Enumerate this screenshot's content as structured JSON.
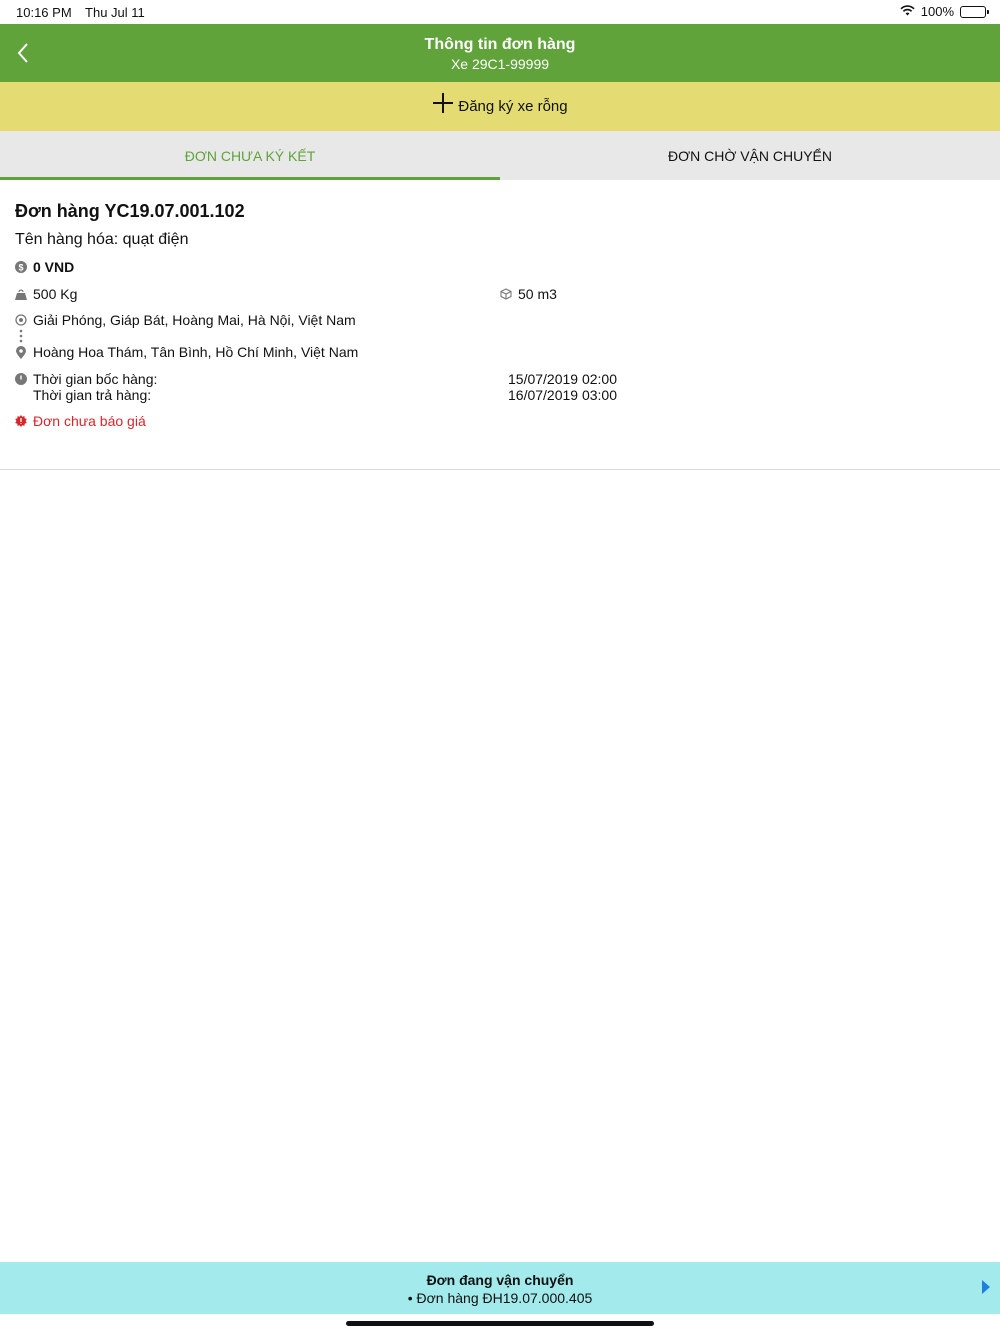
{
  "status_bar": {
    "time": "10:16 PM",
    "date": "Thu Jul 11",
    "battery": "100%"
  },
  "nav": {
    "title": "Thông tin đơn hàng",
    "subtitle": "Xe 29C1-99999"
  },
  "register": {
    "label": "Đăng ký xe rỗng"
  },
  "tabs": [
    {
      "label": "ĐƠN CHƯA KÝ KẾT",
      "active": true
    },
    {
      "label": "ĐƠN CHỜ VẬN CHUYỂN",
      "active": false
    }
  ],
  "order": {
    "title": "Đơn hàng YC19.07.001.102",
    "goods": "Tên hàng hóa: quạt điện",
    "price": "0 VND",
    "weight": "500 Kg",
    "volume": "50 m3",
    "from": "Giải Phóng, Giáp Bát, Hoàng Mai, Hà Nội, Việt Nam",
    "to": "Hoàng Hoa Thám, Tân Bình, Hồ Chí Minh, Việt Nam",
    "pickup_label": "Thời gian bốc hàng:",
    "delivery_label": "Thời gian trả hàng:",
    "pickup_time": "15/07/2019 02:00",
    "delivery_time": "16/07/2019 03:00",
    "status": "Đơn chưa báo giá"
  },
  "bottom": {
    "title": "Đơn đang vận chuyển",
    "item": "• Đơn hàng ĐH19.07.000.405"
  },
  "colors": {
    "primary_green": "#5fa33a",
    "register_yellow": "#e4dc73",
    "bottom_cyan": "#a3eaec",
    "alert_red": "#d7262b",
    "arrow_blue": "#1f7fe0"
  }
}
